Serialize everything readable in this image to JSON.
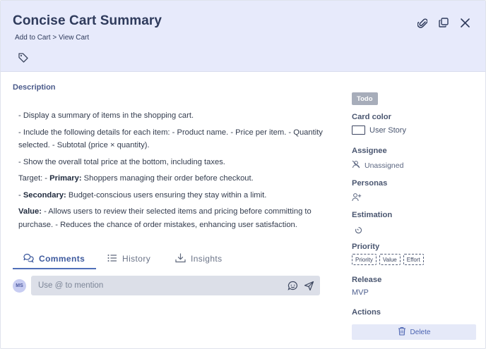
{
  "header": {
    "title": "Concise Cart Summary",
    "breadcrumb": "Add to Cart > View Cart",
    "icons": [
      "paperclip-icon",
      "copy-icon",
      "close-icon",
      "tag-icon"
    ]
  },
  "description": {
    "heading": "Description",
    "line1": "- Display a summary of items in the shopping cart.",
    "line2": "- Include the following details for each item: - Product name. - Price per item. - Quantity selected. - Subtotal (price × quantity).",
    "line3": "- Show the overall total price at the bottom, including taxes.",
    "target_prefix": "Target: - ",
    "primary_label": "Primary:",
    "primary_text": " Shoppers managing their order before checkout.",
    "secondary_prefix": "- ",
    "secondary_label": "Secondary:",
    "secondary_text": " Budget-conscious users ensuring they stay within a limit.",
    "value_label": "Value:",
    "value_text": " - Allows users to review their selected items and pricing before committing to purchase. - Reduces the chance of order mistakes, enhancing user satisfaction."
  },
  "tabs": [
    {
      "label": "Comments",
      "icon": "comments-icon",
      "active": true
    },
    {
      "label": "History",
      "icon": "list-icon",
      "active": false
    },
    {
      "label": "Insights",
      "icon": "download-icon",
      "active": false
    }
  ],
  "comment": {
    "avatar_initials": "MS",
    "placeholder": "Use @ to mention"
  },
  "sidebar": {
    "status": "Todo",
    "card_color_label": "Card color",
    "card_color_value": "User Story",
    "assignee_label": "Assignee",
    "assignee_value": "Unassigned",
    "personas_label": "Personas",
    "estimation_label": "Estimation",
    "priority_label": "Priority",
    "priority_options": [
      "Priority",
      "Value",
      "Effort"
    ],
    "release_label": "Release",
    "release_value": "MVP",
    "actions_label": "Actions",
    "delete_label": "Delete"
  },
  "colors": {
    "header_bg": "#e7eafb",
    "accent": "#4f6fb8",
    "status_badge": "#a7adba"
  }
}
